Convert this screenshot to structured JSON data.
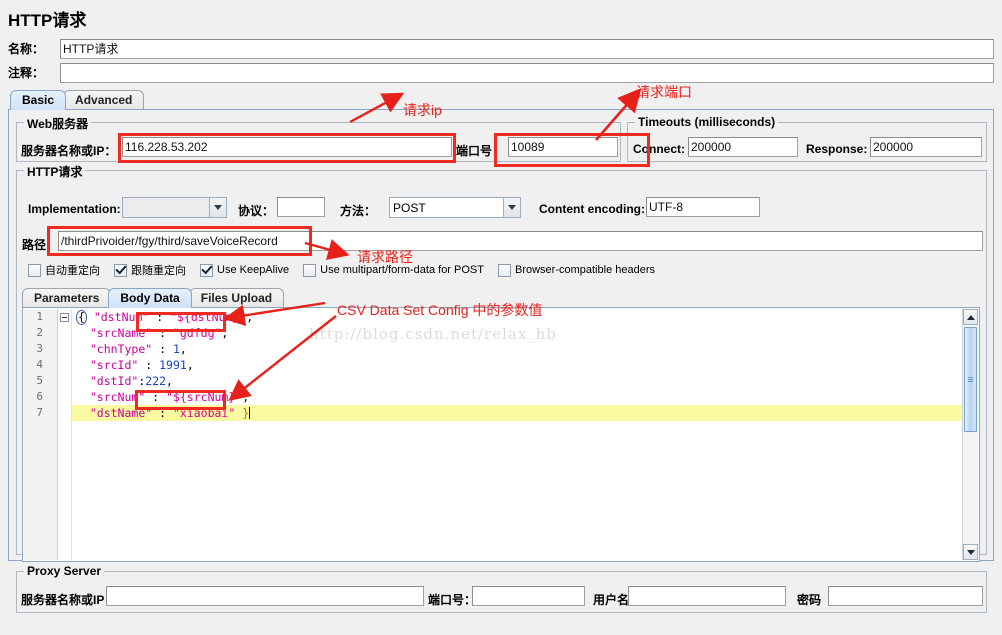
{
  "page": {
    "title": "HTTP请求"
  },
  "form": {
    "name_label": "名称：",
    "name_value": "HTTP请求",
    "comment_label": "注释：",
    "comment_value": ""
  },
  "tabs": [
    {
      "label": "Basic",
      "selected": true
    },
    {
      "label": "Advanced",
      "selected": false
    }
  ],
  "web_server": {
    "legend": "Web服务器",
    "server_label": "服务器名称或IP：",
    "server_value": "116.228.53.202",
    "port_label": "端口号：",
    "port_value": "10089"
  },
  "timeouts": {
    "legend": "Timeouts (milliseconds)",
    "connect_label": "Connect:",
    "connect_value": "200000",
    "response_label": "Response:",
    "response_value": "200000"
  },
  "http_request": {
    "legend": "HTTP请求",
    "implementation_label": "Implementation:",
    "implementation_value": "",
    "protocol_label": "协议：",
    "protocol_value": "",
    "method_label": "方法：",
    "method_value": "POST",
    "encoding_label": "Content encoding:",
    "encoding_value": "UTF-8",
    "path_label": "路径：",
    "path_value": "/thirdPrivoider/fgy/third/saveVoiceRecord",
    "checkboxes": [
      {
        "label": "自动重定向",
        "checked": false
      },
      {
        "label": "跟随重定向",
        "checked": true
      },
      {
        "label": "Use KeepAlive",
        "checked": true
      },
      {
        "label": "Use multipart/form-data for POST",
        "checked": false
      },
      {
        "label": "Browser-compatible headers",
        "checked": false
      }
    ]
  },
  "data_tabs": [
    {
      "label": "Parameters",
      "selected": false
    },
    {
      "label": "Body Data",
      "selected": true
    },
    {
      "label": "Files Upload",
      "selected": false
    }
  ],
  "editor": {
    "watermark": "http://blog.csdn.net/relax_hb",
    "lines": [
      {
        "num": "1",
        "fold": true,
        "current": false,
        "tokens": [
          {
            "t": "brace-hl",
            "v": "{"
          },
          {
            "t": "plain",
            "v": " "
          },
          {
            "t": "key",
            "v": "\"dstNum\""
          },
          {
            "t": "plain",
            "v": " : "
          },
          {
            "t": "str",
            "v": "\"${dstNum}\""
          },
          {
            "t": "plain",
            "v": ","
          }
        ]
      },
      {
        "num": "2",
        "fold": false,
        "current": false,
        "tokens": [
          {
            "t": "plain",
            "v": "  "
          },
          {
            "t": "key",
            "v": "\"srcName\""
          },
          {
            "t": "plain",
            "v": " : "
          },
          {
            "t": "str",
            "v": "\"gdfdg\""
          },
          {
            "t": "plain",
            "v": ","
          }
        ]
      },
      {
        "num": "3",
        "fold": false,
        "current": false,
        "tokens": [
          {
            "t": "plain",
            "v": "  "
          },
          {
            "t": "key",
            "v": "\"chnType\""
          },
          {
            "t": "plain",
            "v": " : "
          },
          {
            "t": "num",
            "v": "1"
          },
          {
            "t": "plain",
            "v": ","
          }
        ]
      },
      {
        "num": "4",
        "fold": false,
        "current": false,
        "tokens": [
          {
            "t": "plain",
            "v": "  "
          },
          {
            "t": "key",
            "v": "\"srcId\""
          },
          {
            "t": "plain",
            "v": " : "
          },
          {
            "t": "num",
            "v": "1991"
          },
          {
            "t": "plain",
            "v": ","
          }
        ]
      },
      {
        "num": "5",
        "fold": false,
        "current": false,
        "tokens": [
          {
            "t": "plain",
            "v": "  "
          },
          {
            "t": "key",
            "v": "\"dstId\""
          },
          {
            "t": "plain",
            "v": ":"
          },
          {
            "t": "num",
            "v": "222"
          },
          {
            "t": "plain",
            "v": ","
          }
        ]
      },
      {
        "num": "6",
        "fold": false,
        "current": false,
        "tokens": [
          {
            "t": "plain",
            "v": "  "
          },
          {
            "t": "key",
            "v": "\"srcNum\""
          },
          {
            "t": "plain",
            "v": " : "
          },
          {
            "t": "str",
            "v": "\"${srcNum}\""
          },
          {
            "t": "plain",
            "v": ","
          }
        ]
      },
      {
        "num": "7",
        "fold": false,
        "current": true,
        "tokens": [
          {
            "t": "plain",
            "v": "  "
          },
          {
            "t": "key",
            "v": "\"dstName\""
          },
          {
            "t": "plain",
            "v": " : "
          },
          {
            "t": "str",
            "v": "\"xiaobai\""
          },
          {
            "t": "plain",
            "v": " "
          },
          {
            "t": "brace",
            "v": "}"
          },
          {
            "t": "caret",
            "v": ""
          }
        ]
      }
    ]
  },
  "proxy_server": {
    "legend": "Proxy Server",
    "server_label": "服务器名称或IP：",
    "server_value": "",
    "port_label": "端口号：",
    "port_value": "",
    "username_label": "用户名",
    "username_value": "",
    "password_label": "密码",
    "password_value": ""
  },
  "annotations": [
    {
      "id": "ann-request-ip",
      "text": "请求ip"
    },
    {
      "id": "ann-request-port",
      "text": "请求端口"
    },
    {
      "id": "ann-request-path",
      "text": "请求路径"
    },
    {
      "id": "ann-csv-config",
      "text": "CSV Data Set Config 中的参数值"
    }
  ],
  "colors": {
    "annotation_red": "#e8201a",
    "panel_bg": "#f0f0f0",
    "tab_selected": "#cfe2f7",
    "current_line": "#fafaa0"
  }
}
